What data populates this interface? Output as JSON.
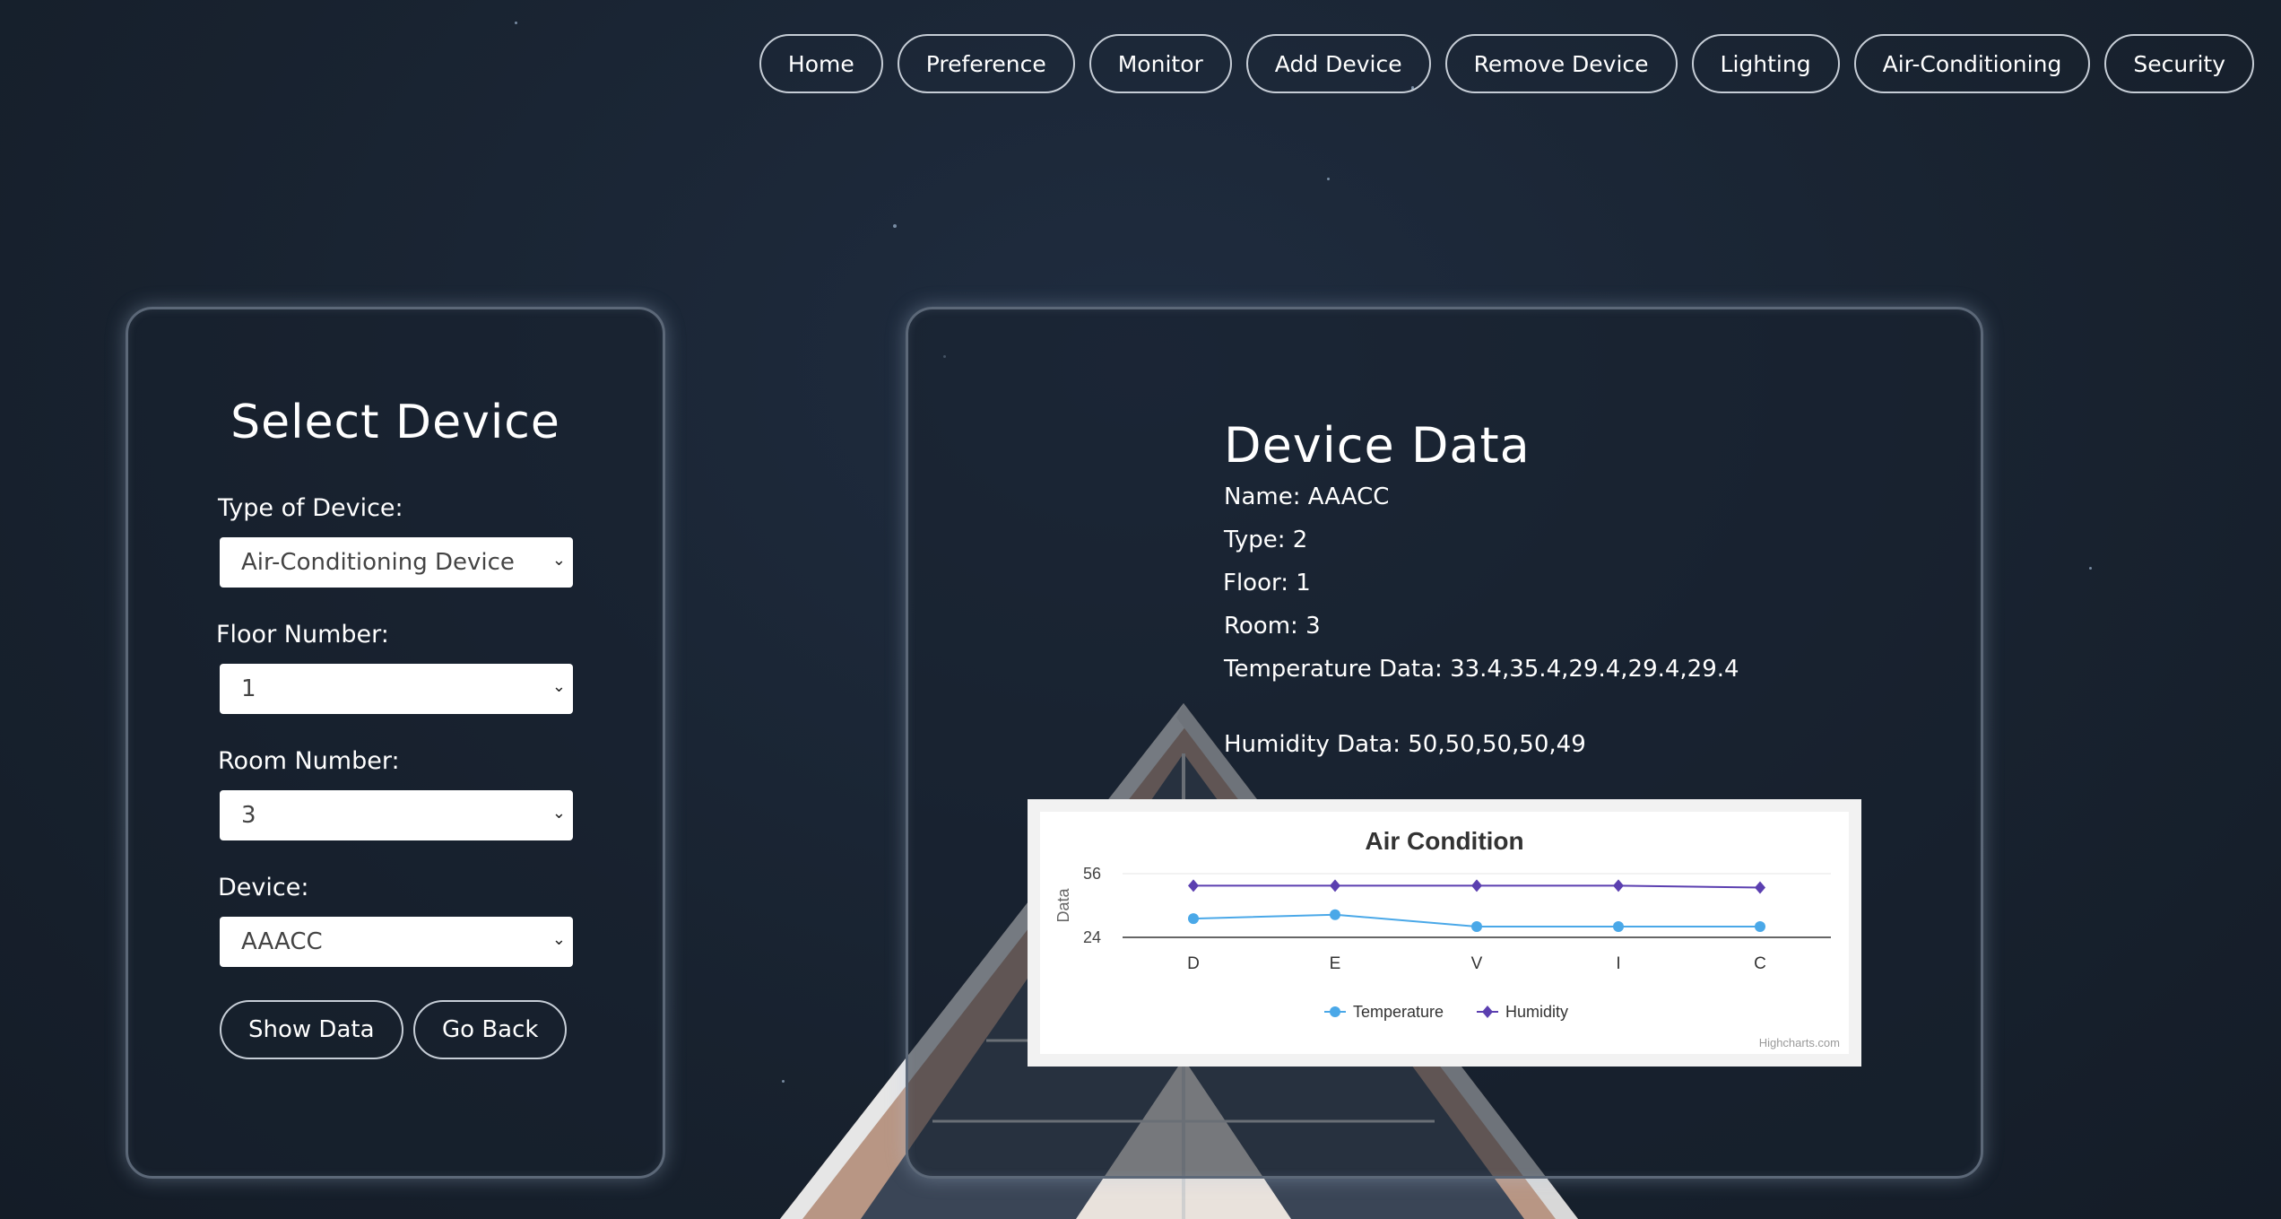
{
  "nav": {
    "items": [
      "Home",
      "Preference",
      "Monitor",
      "Add Device",
      "Remove Device",
      "Lighting",
      "Air-Conditioning",
      "Security"
    ]
  },
  "select_device": {
    "title": "Select Device",
    "type_label": "Type of Device:",
    "type_value": "Air-Conditioning Device",
    "floor_label": "Floor Number:",
    "floor_value": "1",
    "room_label": "Room Number:",
    "room_value": "3",
    "device_label": "Device:",
    "device_value": "AAACC",
    "show_button": "Show Data",
    "back_button": "Go Back"
  },
  "device_data": {
    "title": "Device Data",
    "name": "Name: AAACC",
    "type": "Type: 2",
    "floor": "Floor: 1",
    "room": "Room: 3",
    "temperature": "Temperature Data: 33.4,35.4,29.4,29.4,29.4",
    "humidity": "Humidity Data: 50,50,50,50,49"
  },
  "chart_data": {
    "type": "line",
    "title": "Air Condition",
    "ylabel": "Data",
    "xlabel": "",
    "categories": [
      "D",
      "E",
      "V",
      "I",
      "C"
    ],
    "yticks": [
      24,
      56
    ],
    "ylim": [
      24,
      56
    ],
    "series": [
      {
        "name": "Temperature",
        "values": [
          33.4,
          35.4,
          29.4,
          29.4,
          29.4
        ],
        "color": "#4aa8e8",
        "marker": "circle"
      },
      {
        "name": "Humidity",
        "values": [
          50,
          50,
          50,
          50,
          49
        ],
        "color": "#5b3fb0",
        "marker": "diamond"
      }
    ],
    "legend": "bottom-center",
    "credits": "Highcharts.com"
  }
}
